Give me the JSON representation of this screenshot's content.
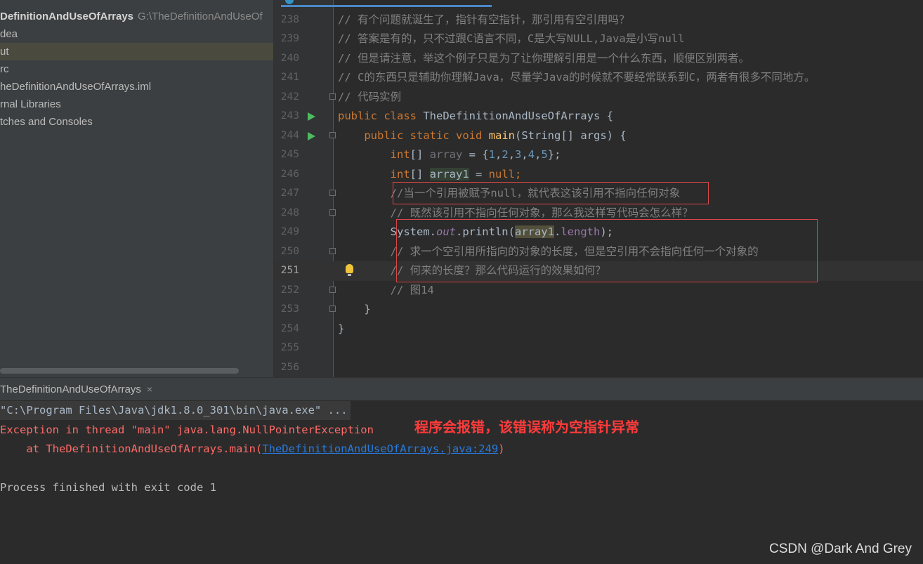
{
  "project": {
    "root_name": "DefinitionAndUseOfArrays",
    "root_path": "G:\\TheDefinitionAndUseOf",
    "items": [
      {
        "label": "dea"
      },
      {
        "label": "ut"
      },
      {
        "label": "rc"
      },
      {
        "label": "heDefinitionAndUseOfArrays.iml"
      },
      {
        "label": "rnal Libraries"
      },
      {
        "label": "tches and Consoles"
      }
    ],
    "selected_index": 1
  },
  "editor": {
    "current_line": "251",
    "lines": [
      {
        "num": "238",
        "text": "// 有个问题就诞生了，指针有空指针，那引用有空引用吗？"
      },
      {
        "num": "239",
        "text": "// 答案是有的，只不过跟C语言不同，C是大写NULL,Java是小写null"
      },
      {
        "num": "240",
        "text": "// 但是请注意，举这个例子只是为了让你理解引用是一个什么东西，顺便区别两者。"
      },
      {
        "num": "241",
        "text": "// C的东西只是辅助你理解Java，尽量学Java的时候就不要经常联系到C，两者有很多不同地方。"
      },
      {
        "num": "242",
        "text": "// 代码实例"
      },
      {
        "num": "243",
        "parts": [
          "public",
          " ",
          "class",
          " TheDefinitionAndUseOfArrays {"
        ]
      },
      {
        "num": "244",
        "parts": [
          "    ",
          "public",
          " ",
          "static",
          " ",
          "void",
          " ",
          "main",
          "(String[] args) {"
        ]
      },
      {
        "num": "245",
        "parts": [
          "        ",
          "int",
          "[] ",
          "array",
          " = {",
          "1",
          ",",
          "2",
          ",",
          "3",
          ",",
          "4",
          ",",
          "5",
          "};"
        ]
      },
      {
        "num": "246",
        "parts": [
          "        ",
          "int",
          "[] ",
          "array1",
          " = ",
          "null",
          ";"
        ]
      },
      {
        "num": "247",
        "text": "        //当一个引用被赋予null，就代表这该引用不指向任何对象"
      },
      {
        "num": "248",
        "text": "        // 既然该引用不指向任何对象，那么我这样写代码会怎么样？"
      },
      {
        "num": "249",
        "parts": [
          "        System.",
          "out",
          ".println(",
          "array1",
          ".",
          "length",
          ");"
        ]
      },
      {
        "num": "250",
        "text": "        // 求一个空引用所指向的对象的长度，但是空引用不会指向任何一个对象的"
      },
      {
        "num": "251",
        "text": "        // 何来的长度？那么代码运行的效果如何？"
      },
      {
        "num": "252",
        "text": "        // 图14"
      },
      {
        "num": "253",
        "text": "    }"
      },
      {
        "num": "254",
        "text": "}"
      },
      {
        "num": "255",
        "text": ""
      },
      {
        "num": "256",
        "text": ""
      }
    ]
  },
  "run_panel": {
    "tab_label": "TheDefinitionAndUseOfArrays",
    "close_glyph": "×",
    "command": "\"C:\\Program Files\\Java\\jdk1.8.0_301\\bin\\java.exe\" ...",
    "exception": "Exception in thread \"main\" java.lang.NullPointerException",
    "stack_prefix": "    at TheDefinitionAndUseOfArrays.main(",
    "stack_link": "TheDefinitionAndUseOfArrays.java:249",
    "stack_suffix": ")",
    "finished": "Process finished with exit code 1"
  },
  "annotation": "程序会报错，该错误称为空指针异常",
  "watermark": "CSDN @Dark And Grey",
  "colors": {
    "keyword": "#cc7832",
    "comment": "#808080",
    "number": "#6897bb",
    "error": "#ff6b68",
    "annotation_box": "#d94848"
  }
}
